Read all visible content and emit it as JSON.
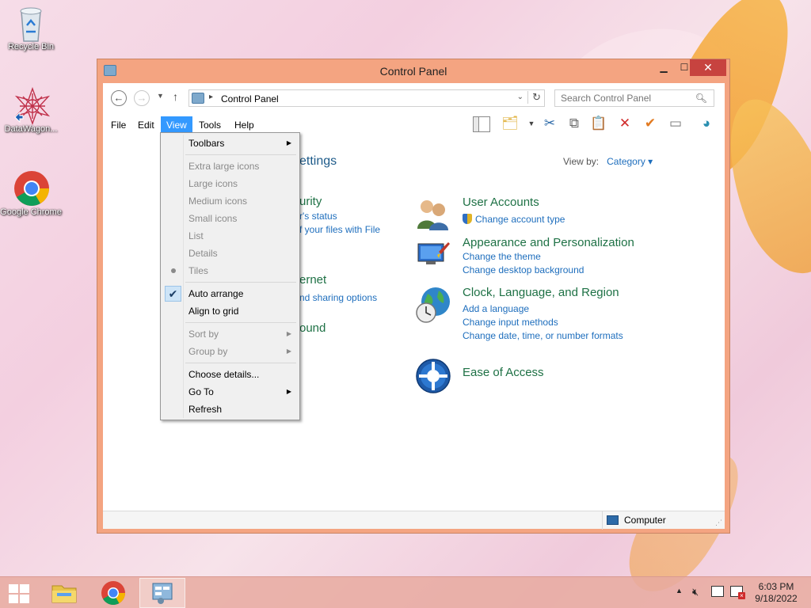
{
  "desktop": {
    "icons": [
      {
        "label": "Recycle Bin"
      },
      {
        "label": "DataWagon..."
      },
      {
        "label": "Google Chrome"
      }
    ]
  },
  "window": {
    "title": "Control Panel",
    "address": {
      "path": "Control Panel"
    },
    "search": {
      "placeholder": "Search Control Panel"
    },
    "menu": [
      "File",
      "Edit",
      "View",
      "Tools",
      "Help"
    ],
    "view_by_label": "View by:",
    "view_by_value": "Category",
    "partial_left": {
      "settings_heading": "ettings",
      "security_heading": "urity",
      "security_link1": "r's status",
      "security_link2": "f your files with File",
      "internet_heading": "ernet",
      "internet_link": "nd sharing options",
      "sound_heading": "ound"
    },
    "categories": [
      {
        "heading": "User Accounts",
        "links": [
          "Change account type"
        ]
      },
      {
        "heading": "Appearance and Personalization",
        "links": [
          "Change the theme",
          "Change desktop background"
        ]
      },
      {
        "heading": "Clock, Language, and Region",
        "links": [
          "Add a language",
          "Change input methods",
          "Change date, time, or number formats"
        ]
      },
      {
        "heading": "Ease of Access",
        "links": []
      }
    ],
    "status": {
      "location": "Computer"
    }
  },
  "view_menu": {
    "items": [
      {
        "label": "Toolbars",
        "state": "submenu"
      },
      {
        "label": "Extra large icons",
        "state": "disabled"
      },
      {
        "label": "Large icons",
        "state": "disabled"
      },
      {
        "label": "Medium icons",
        "state": "disabled"
      },
      {
        "label": "Small icons",
        "state": "disabled"
      },
      {
        "label": "List",
        "state": "disabled"
      },
      {
        "label": "Details",
        "state": "disabled"
      },
      {
        "label": "Tiles",
        "state": "disabled-selected"
      },
      {
        "label": "Auto arrange",
        "state": "checked"
      },
      {
        "label": "Align to grid",
        "state": "normal"
      },
      {
        "label": "Sort by",
        "state": "disabled-submenu"
      },
      {
        "label": "Group by",
        "state": "disabled-submenu"
      },
      {
        "label": "Choose details...",
        "state": "normal"
      },
      {
        "label": "Go To",
        "state": "submenu"
      },
      {
        "label": "Refresh",
        "state": "normal"
      }
    ]
  },
  "taskbar": {
    "time": "6:03 PM",
    "date": "9/18/2022"
  },
  "colors": {
    "accent": "#3399ff",
    "link": "#1e6ebd",
    "heading": "#1e7145",
    "close": "#c7433f"
  }
}
